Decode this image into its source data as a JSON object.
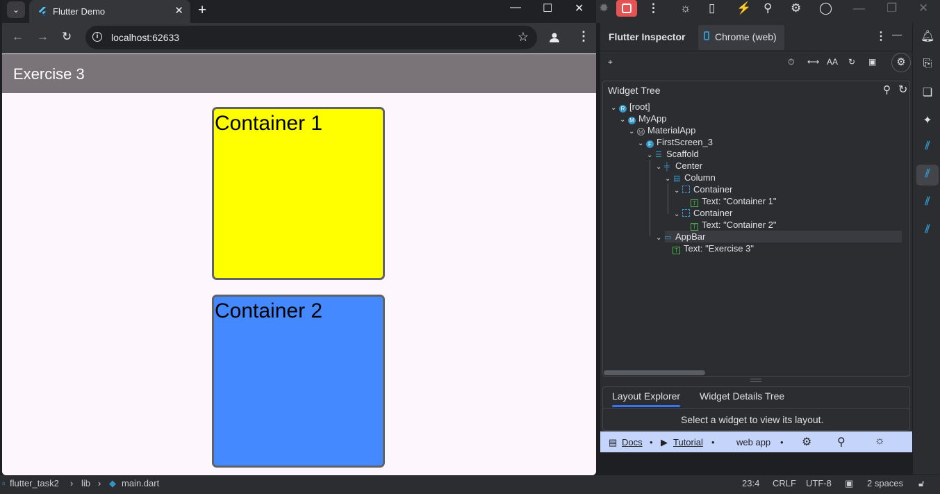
{
  "browser": {
    "tab_title": "Flutter Demo",
    "url": "localhost:62633",
    "new_tab": "+",
    "close_tab": "✕"
  },
  "app": {
    "appbar_title": "Exercise 3",
    "container1_text": "Container 1",
    "container2_text": "Container 2",
    "container1_color": "#ffff00",
    "container2_color": "#4489ff"
  },
  "inspector": {
    "tab_inspector": "Flutter Inspector",
    "tab_device": "Chrome (web)",
    "widget_tree_title": "Widget Tree",
    "tree": [
      {
        "badge": "R",
        "label": "[root]"
      },
      {
        "badge": "M",
        "label": "MyApp"
      },
      {
        "badge": "M",
        "label": "MaterialApp"
      },
      {
        "badge": "F",
        "label": "FirstScreen_3"
      },
      {
        "badge": "",
        "label": "Scaffold"
      },
      {
        "badge": "",
        "label": "Center"
      },
      {
        "badge": "",
        "label": "Column"
      },
      {
        "badge": "",
        "label": "Container"
      },
      {
        "badge": "T",
        "label": "Text: \"Container 1\""
      },
      {
        "badge": "",
        "label": "Container"
      },
      {
        "badge": "T",
        "label": "Text: \"Container 2\""
      },
      {
        "badge": "",
        "label": "AppBar"
      },
      {
        "badge": "T",
        "label": "Text: \"Exercise 3\""
      }
    ],
    "layout_explorer": "Layout Explorer",
    "widget_details_tree": "Widget Details Tree",
    "select_message": "Select a widget to view its layout.",
    "footer": {
      "docs": "Docs",
      "tutorial": "Tutorial",
      "mode": "web app",
      "dot": "•"
    }
  },
  "statusbar": {
    "project": "flutter_task2",
    "folder": "lib",
    "file": "main.dart",
    "position": "23:4",
    "line_ending": "CRLF",
    "encoding": "UTF-8",
    "indent": "2 spaces"
  }
}
